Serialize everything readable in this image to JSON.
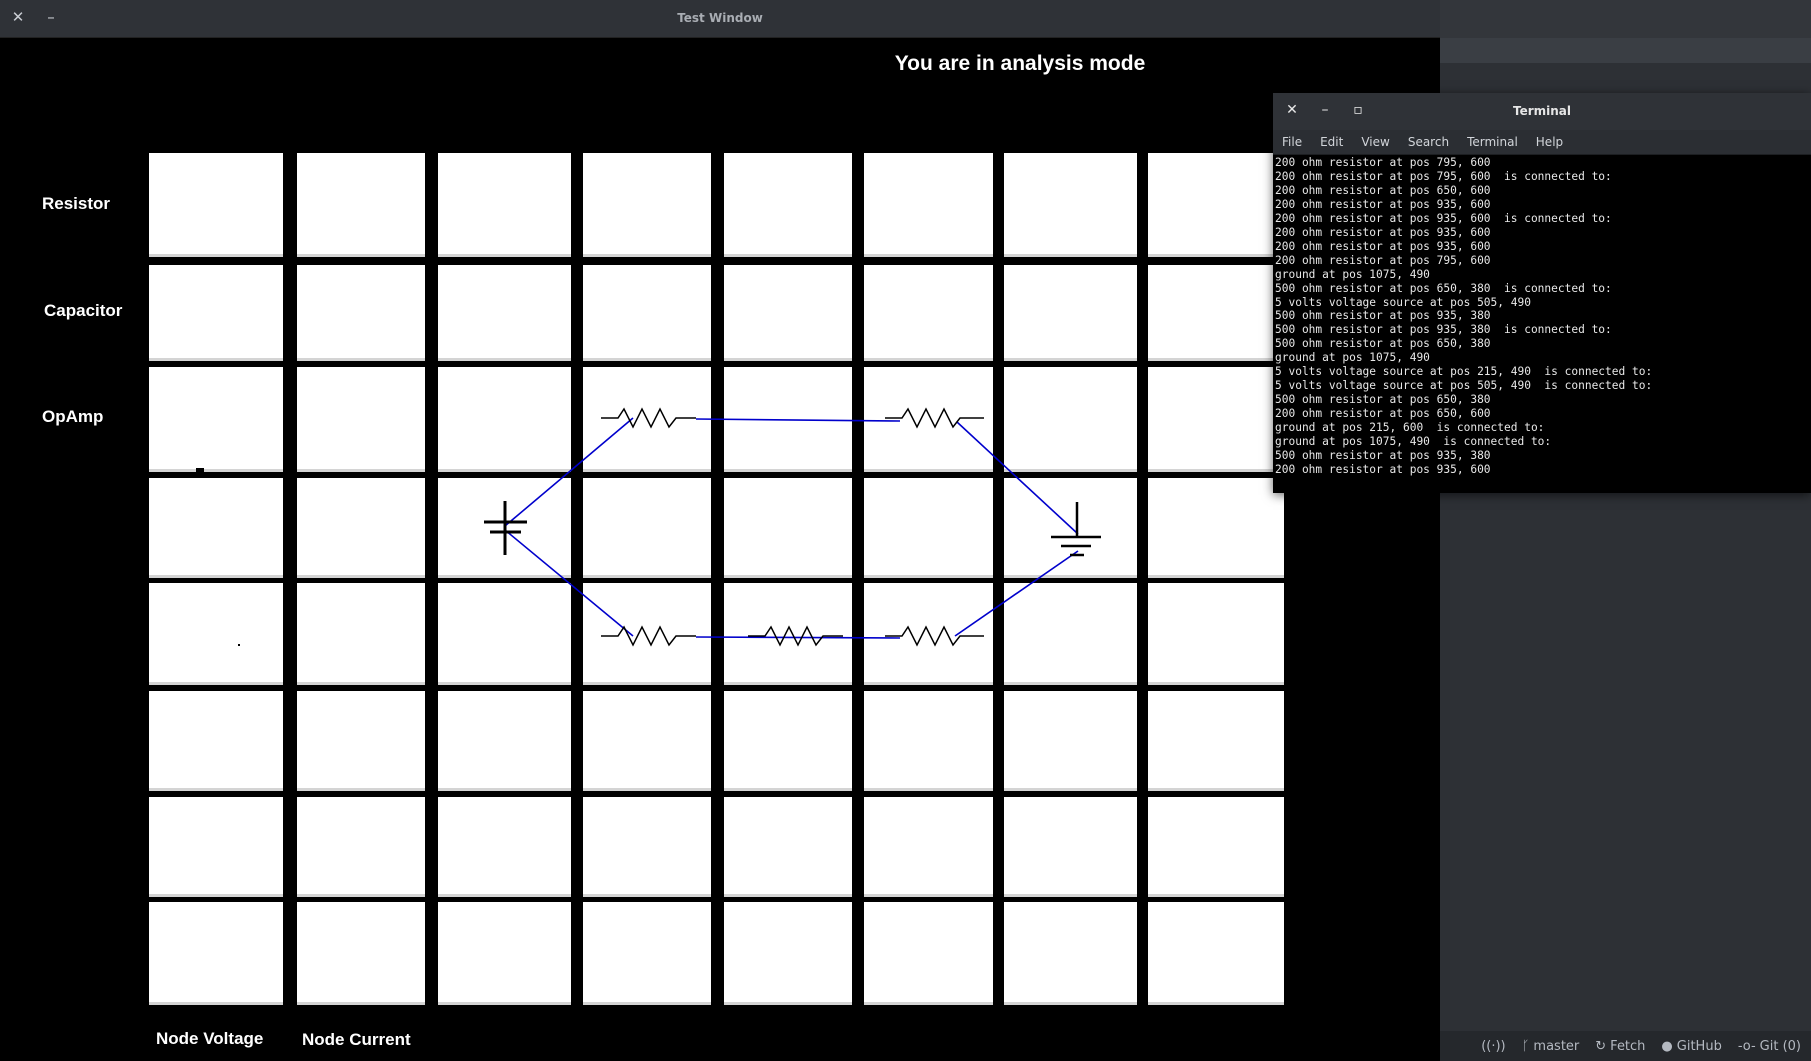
{
  "app_window": {
    "title": "Test Window",
    "close_label": "✕",
    "minimize_label": "–",
    "mode_text": "You are in analysis mode",
    "palette": [
      "Resistor",
      "Capacitor",
      "OpAmp"
    ],
    "bottom_buttons": [
      "Node Voltage",
      "Node Current"
    ],
    "grid": {
      "rows": 8,
      "cols": 8
    },
    "circuit": {
      "wire_color": "#0000cc",
      "components": [
        {
          "type": "voltage-source",
          "label": "5 volts voltage source"
        },
        {
          "type": "resistor",
          "label": "500 ohm resistor"
        },
        {
          "type": "resistor",
          "label": "500 ohm resistor"
        },
        {
          "type": "ground",
          "label": "ground"
        },
        {
          "type": "resistor",
          "label": "200 ohm resistor"
        },
        {
          "type": "resistor",
          "label": "200 ohm resistor"
        },
        {
          "type": "resistor",
          "label": "200 ohm resistor"
        }
      ]
    }
  },
  "terminal": {
    "title": "Terminal",
    "close_label": "✕",
    "minimize_label": "–",
    "maximize_label": "▫",
    "menu": [
      "File",
      "Edit",
      "View",
      "Search",
      "Terminal",
      "Help"
    ],
    "lines": [
      "200 ohm resistor at pos 795, 600",
      "200 ohm resistor at pos 795, 600  is connected to:",
      "200 ohm resistor at pos 650, 600",
      "200 ohm resistor at pos 935, 600",
      "200 ohm resistor at pos 935, 600  is connected to:",
      "200 ohm resistor at pos 935, 600",
      "200 ohm resistor at pos 935, 600",
      "200 ohm resistor at pos 795, 600",
      "ground at pos 1075, 490",
      "500 ohm resistor at pos 650, 380  is connected to:",
      "5 volts voltage source at pos 505, 490",
      "500 ohm resistor at pos 935, 380",
      "500 ohm resistor at pos 935, 380  is connected to:",
      "500 ohm resistor at pos 650, 380",
      "ground at pos 1075, 490",
      "5 volts voltage source at pos 215, 490  is connected to:",
      "5 volts voltage source at pos 505, 490  is connected to:",
      "500 ohm resistor at pos 650, 380",
      "200 ohm resistor at pos 650, 600",
      "ground at pos 215, 600  is connected to:",
      "ground at pos 1075, 490  is connected to:",
      "500 ohm resistor at pos 935, 380",
      "200 ohm resistor at pos 935, 600"
    ]
  },
  "status_bar": {
    "items": [
      {
        "icon": "broadcast-icon",
        "glyph": "((·))",
        "label": ""
      },
      {
        "icon": "git-branch-icon",
        "glyph": "ᚴ",
        "label": "master"
      },
      {
        "icon": "fetch-icon",
        "glyph": "↻",
        "label": "Fetch"
      },
      {
        "icon": "github-icon",
        "glyph": "●",
        "label": "GitHub"
      },
      {
        "icon": "git-commit-icon",
        "glyph": "-o-",
        "label": "Git (0)"
      }
    ]
  }
}
